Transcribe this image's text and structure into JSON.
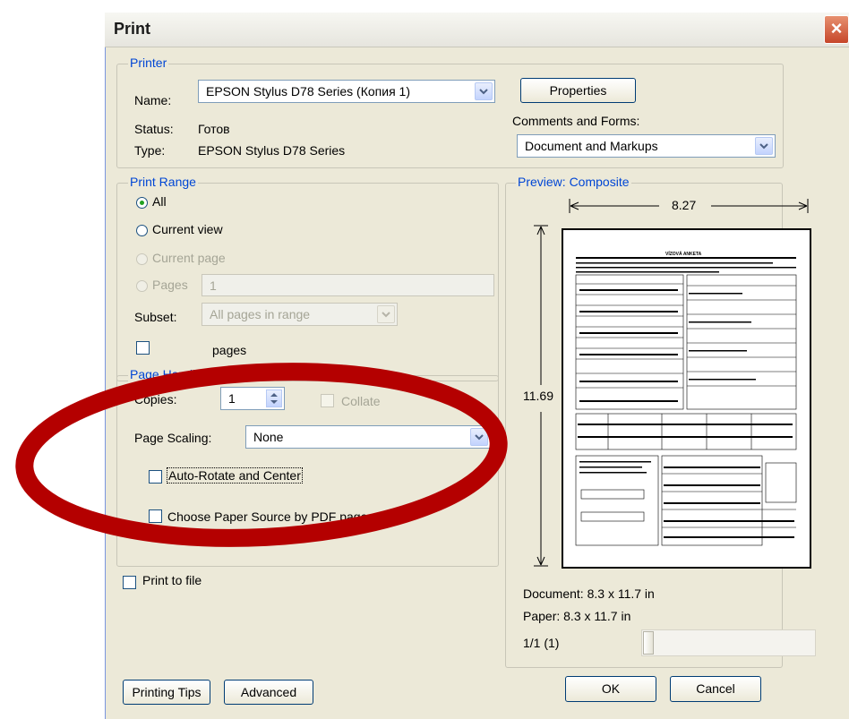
{
  "window": {
    "title": "Print",
    "close_symbol": "×"
  },
  "printer": {
    "legend": "Printer",
    "name_label": "Name:",
    "name_value": "EPSON Stylus D78 Series (Копия 1)",
    "status_label": "Status:",
    "status_value": "Готов",
    "type_label": "Type:",
    "type_value": "EPSON Stylus D78 Series",
    "properties_label": "Properties",
    "comments_label": "Comments and Forms:",
    "comments_value": "Document and Markups"
  },
  "print_range": {
    "legend": "Print Range",
    "all_label": "All",
    "current_view_label": "Current view",
    "current_page_label": "Current page",
    "pages_label": "Pages",
    "pages_value": "1",
    "subset_label": "Subset:",
    "subset_value": "All pages in range",
    "reverse_label": "pages"
  },
  "page_handling": {
    "legend": "Page Handling",
    "copies_label": "Copies:",
    "copies_value": "1",
    "collate_label": "Collate",
    "scaling_label": "Page Scaling:",
    "scaling_value": "None",
    "autorotate_label": "Auto-Rotate and Center",
    "paper_source_label": "Choose Paper Source by PDF page size"
  },
  "print_to_file_label": "Print to file",
  "preview": {
    "legend": "Preview: Composite",
    "width_value": "8.27",
    "height_value": "11.69",
    "form_title": "VÍZOVÁ ANKETA",
    "document_size": "Document: 8.3 x 11.7 in",
    "paper_size": "Paper: 8.3 x 11.7 in",
    "page_indicator": "1/1 (1)"
  },
  "buttons": {
    "printing_tips": "Printing Tips",
    "advanced": "Advanced",
    "ok": "OK",
    "cancel": "Cancel"
  },
  "colors": {
    "legend_blue": "#0046d5",
    "dialog_bg": "#ece9d8",
    "annotation_red": "#b40000"
  }
}
